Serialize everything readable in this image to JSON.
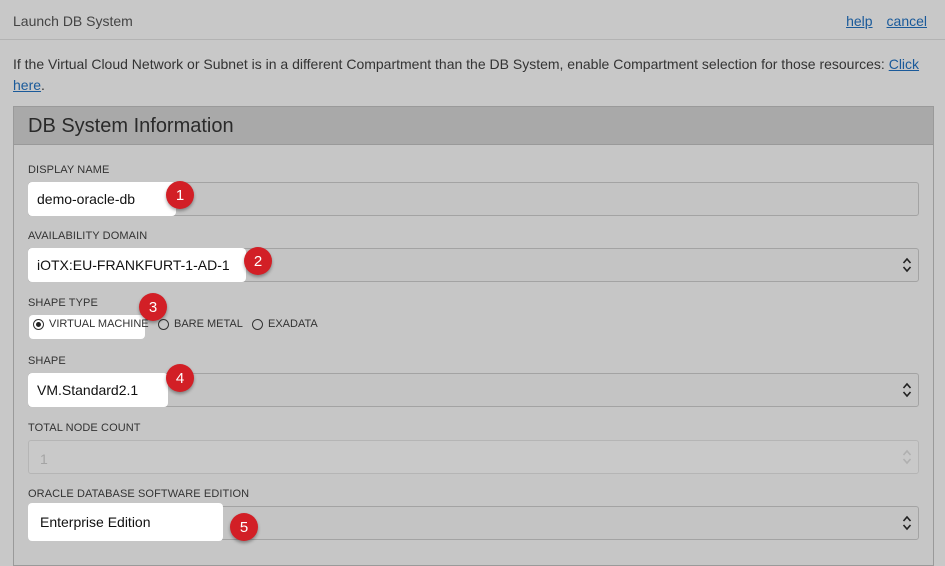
{
  "window": {
    "title": "Launch DB System",
    "help_link": "help",
    "cancel_link": "cancel"
  },
  "intro": {
    "text": "If the Virtual Cloud Network or Subnet is in a different Compartment than the DB System, enable Compartment selection for those resources: ",
    "link": "Click here",
    "suffix": "."
  },
  "section": {
    "title": "DB System Information"
  },
  "form": {
    "display_name": {
      "label": "DISPLAY NAME",
      "value": "demo-oracle-db",
      "badge": "1"
    },
    "availability_domain": {
      "label": "AVAILABILITY DOMAIN",
      "value": "iOTX:EU-FRANKFURT-1-AD-1",
      "badge": "2"
    },
    "shape_type": {
      "label": "SHAPE TYPE",
      "badge": "3",
      "options": [
        "VIRTUAL MACHINE",
        "BARE METAL",
        "EXADATA"
      ],
      "selected": "VIRTUAL MACHINE"
    },
    "shape": {
      "label": "SHAPE",
      "value": "VM.Standard2.1",
      "badge": "4"
    },
    "total_node_count": {
      "label": "TOTAL NODE COUNT",
      "value": "1"
    },
    "software_edition": {
      "label": "ORACLE DATABASE SOFTWARE EDITION",
      "value": "Enterprise Edition",
      "badge": "5"
    }
  },
  "colors": {
    "badge": "#d21f26",
    "link": "#1a5a9a",
    "overlay_bg": "#c8c8c8"
  }
}
